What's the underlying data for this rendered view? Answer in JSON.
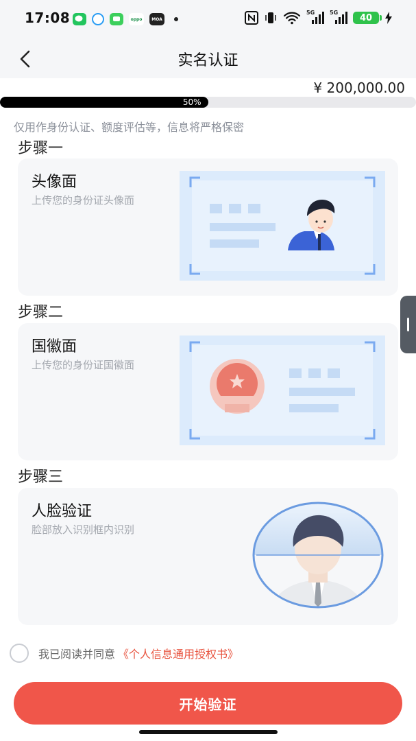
{
  "status_bar": {
    "time": "17:08",
    "apps": [
      "wechat-icon",
      "browser-icon",
      "messages-icon",
      "oppo-icon",
      "moa-icon"
    ],
    "network_1": "5G",
    "network_2": "5G",
    "battery": "40"
  },
  "nav": {
    "title": "实名认证"
  },
  "summary": {
    "amount": "¥ 200,000.00",
    "progress_value": 0.5,
    "progress_label": "50%",
    "notice": "仅用作身份认证、额度评估等，信息将严格保密"
  },
  "steps": [
    {
      "step_label": "步骤一",
      "title": "头像面",
      "subtitle": "上传您的身份证头像面"
    },
    {
      "step_label": "步骤二",
      "title": "国徽面",
      "subtitle": "上传您的身份证国徽面"
    },
    {
      "step_label": "步骤三",
      "title": "人脸验证",
      "subtitle": "脸部放入识别框内识别"
    }
  ],
  "agreement": {
    "text": "我已阅读并同意",
    "link": "《个人信息通用授权书》"
  },
  "actions": {
    "start_label": "开始验证"
  },
  "colors": {
    "accent": "#f0564a",
    "link": "#e8523d",
    "card_bg": "#f6f7f9",
    "progress_fill": "#000000"
  }
}
